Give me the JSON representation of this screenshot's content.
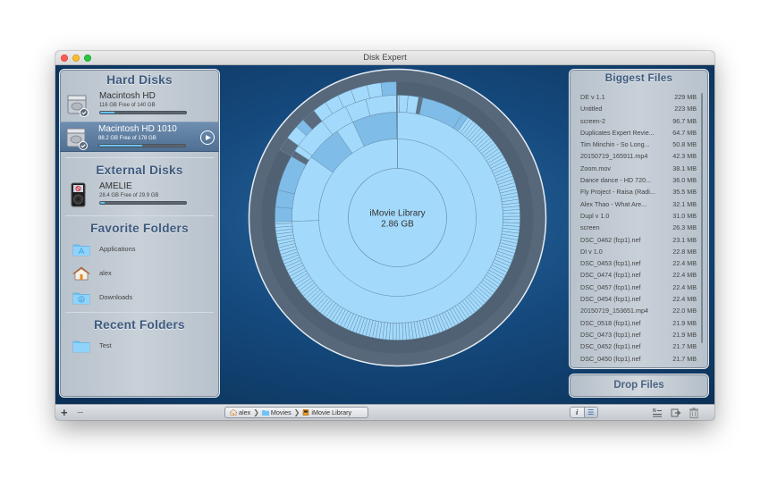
{
  "window": {
    "title": "Disk Expert"
  },
  "sidebar": {
    "hard_disks": {
      "title": "Hard Disks",
      "items": [
        {
          "name": "Macintosh HD",
          "free_text": "116 GB Free of 140 GB",
          "used_fraction": 0.17,
          "selected": false
        },
        {
          "name": "Macintosh HD 1010",
          "free_text": "88.2 GB Free of 178 GB",
          "used_fraction": 0.5,
          "selected": true
        }
      ]
    },
    "external_disks": {
      "title": "External Disks",
      "items": [
        {
          "name": "AMELIE",
          "free_text": "28.4 GB Free of 29.9 GB",
          "used_fraction": 0.05
        }
      ]
    },
    "favorite_folders": {
      "title": "Favorite Folders",
      "items": [
        {
          "label": "Applications",
          "icon": "applications-folder-icon"
        },
        {
          "label": "alex",
          "icon": "home-icon"
        },
        {
          "label": "Downloads",
          "icon": "downloads-folder-icon"
        }
      ]
    },
    "recent_folders": {
      "title": "Recent Folders",
      "items": [
        {
          "label": "Test",
          "icon": "folder-icon"
        }
      ]
    }
  },
  "chart_data": {
    "type": "sunburst",
    "center_label": "iMovie Library",
    "center_value": "2.86 GB",
    "colors": {
      "light": "#a3dafc",
      "medium": "#7fbce8",
      "dark": "#5a6b7d",
      "outer_ring": "#56687a",
      "line": "#6a8ea8"
    }
  },
  "biggest_files": {
    "title": "Biggest Files",
    "items": [
      {
        "name": "DE v 1.1",
        "size": "229 MB"
      },
      {
        "name": "Untitled",
        "size": "223 MB"
      },
      {
        "name": "screen-2",
        "size": "96.7 MB"
      },
      {
        "name": "Duplicates Expert Revie...",
        "size": "64.7 MB"
      },
      {
        "name": "Tim Minchin - So Long...",
        "size": "50.8 MB"
      },
      {
        "name": "20150719_165911.mp4",
        "size": "42.3 MB"
      },
      {
        "name": "Zoom.mov",
        "size": "38.1 MB"
      },
      {
        "name": "Dance dance - HD 720...",
        "size": "36.0 MB"
      },
      {
        "name": "Fly Project - Raisa (Radi...",
        "size": "35.5 MB"
      },
      {
        "name": "Alex Thao - What Are...",
        "size": "32.1 MB"
      },
      {
        "name": "Dupl v 1.0",
        "size": "31.0 MB"
      },
      {
        "name": "screen",
        "size": "26.3 MB"
      },
      {
        "name": "DSC_0462 (fcp1).nef",
        "size": "23.1 MB"
      },
      {
        "name": "DI v 1.0",
        "size": "22.8 MB"
      },
      {
        "name": "DSC_0453 (fcp1).nef",
        "size": "22.4 MB"
      },
      {
        "name": "DSC_0474 (fcp1).nef",
        "size": "22.4 MB"
      },
      {
        "name": "DSC_0457 (fcp1).nef",
        "size": "22.4 MB"
      },
      {
        "name": "DSC_0454 (fcp1).nef",
        "size": "22.4 MB"
      },
      {
        "name": "20150719_153651.mp4",
        "size": "22.0 MB"
      },
      {
        "name": "DSC_0518 (fcp1).nef",
        "size": "21.9 MB"
      },
      {
        "name": "DSC_0473 (fcp1).nef",
        "size": "21.9 MB"
      },
      {
        "name": "DSC_0452 (fcp1).nef",
        "size": "21.7 MB"
      },
      {
        "name": "DSC_0450 (fcp1).nef",
        "size": "21.7 MB"
      }
    ]
  },
  "drop_files": {
    "label": "Drop Files"
  },
  "bottombar": {
    "add_label": "+",
    "remove_label": "−",
    "breadcrumb": [
      "alex",
      "Movies",
      "iMovie Library"
    ],
    "info_label": "i",
    "list_label": "☰"
  }
}
